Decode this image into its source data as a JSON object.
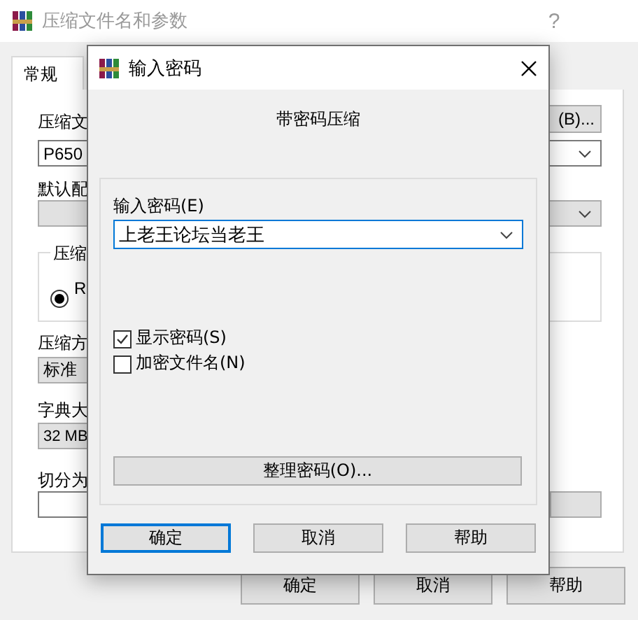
{
  "background_window": {
    "title": "压缩文件名和参数",
    "help": "?",
    "tabs": [
      {
        "label": "常规",
        "selected": true
      }
    ],
    "archive_label": "压缩文",
    "browse_button": "(B)...",
    "archive_name": "P650",
    "profile_label": "默认配",
    "format_group": {
      "legend": "压缩",
      "options": [
        {
          "label": "R",
          "selected": true
        }
      ]
    },
    "method_label": "压缩方",
    "method_value": "标准",
    "dict_label": "字典大",
    "dict_value": "32 MB",
    "split_label": "切分为",
    "buttons": [
      "确定",
      "取消",
      "帮助"
    ]
  },
  "password_dialog": {
    "title": "输入密码",
    "heading": "带密码压缩",
    "password_label": "输入密码(E)",
    "password_value": "上老王论坛当老王",
    "options": [
      {
        "label": "显示密码(S)",
        "checked": true
      },
      {
        "label": "加密文件名(N)",
        "checked": false
      }
    ],
    "organize_button": "整理密码(O)...",
    "buttons": [
      {
        "label": "确定",
        "default": true
      },
      {
        "label": "取消",
        "default": false
      },
      {
        "label": "帮助",
        "default": false
      }
    ]
  }
}
